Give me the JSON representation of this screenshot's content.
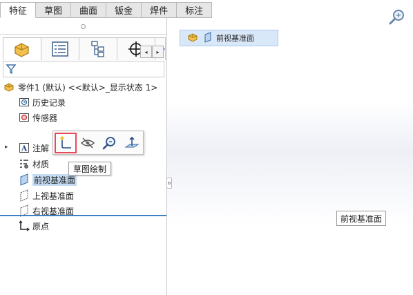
{
  "cmd_tabs": [
    "特征",
    "草图",
    "曲面",
    "钣金",
    "焊件",
    "标注"
  ],
  "active_tab_index": 0,
  "tree": {
    "root": "零件1 (默认) <<默认>_显示状态 1>",
    "items": [
      "历史记录",
      "传感器",
      "注解",
      "材质",
      "前视基准面",
      "上视基准面",
      "右视基准面",
      "原点"
    ]
  },
  "scroll_left": "◂",
  "scroll_right": "▸",
  "expander": "▸",
  "context_toolbar_tooltip": "草图绘制",
  "breadcrumb": {
    "label": "前视基准面"
  },
  "graphics_plane_label": "前视基准面",
  "colors": {
    "selection": "#c4dbf3",
    "highlight": "#e64a5a",
    "accent": "#3b7fc4"
  },
  "icons": [
    "part-icon",
    "property-manager-icon",
    "configuration-manager-icon",
    "dimxpert-icon",
    "display-manager-icon",
    "filter-icon",
    "zoom-to-fit-icon"
  ]
}
